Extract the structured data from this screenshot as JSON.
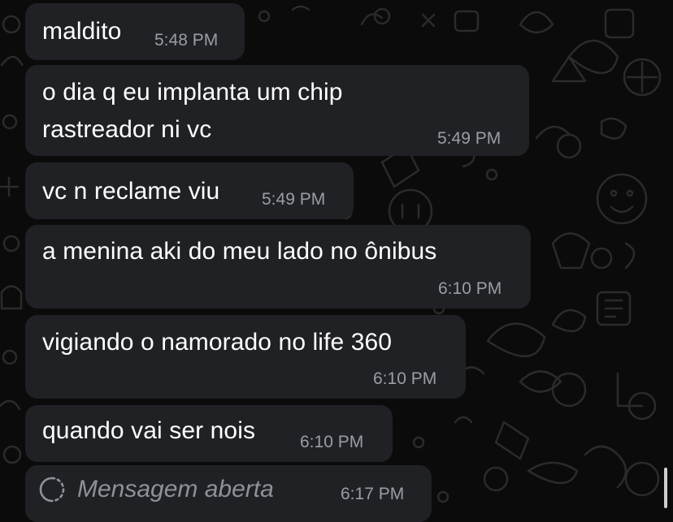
{
  "theme": {
    "background": "#0b0b0b",
    "bubble": "#1f2124",
    "text": "#ffffff",
    "timestamp": "#9a9ea3",
    "doodle": "#2a2a2a"
  },
  "messages": [
    {
      "text_lines": [
        "maldito"
      ],
      "time": "5:48 PM"
    },
    {
      "text_lines": [
        "o dia q eu implanta um chip",
        "rastreador ni vc"
      ],
      "time": "5:49 PM"
    },
    {
      "text_lines": [
        "vc n reclame viu"
      ],
      "time": "5:49 PM"
    },
    {
      "text_lines": [
        "a menina aki do meu lado no ônibus"
      ],
      "time": "6:10 PM"
    },
    {
      "text_lines": [
        "vigiando o namorado no life 360"
      ],
      "time": "6:10 PM"
    },
    {
      "text_lines": [
        "quando vai ser nois"
      ],
      "time": "6:10 PM"
    }
  ],
  "view_once": {
    "icon": "view-once-icon",
    "label": "Mensagem aberta",
    "time": "6:17 PM"
  }
}
